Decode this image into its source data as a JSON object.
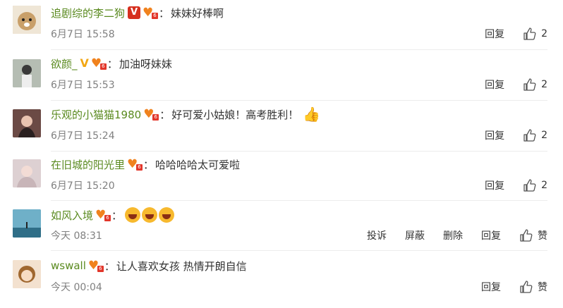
{
  "comments": [
    {
      "user": "追剧综的李二狗",
      "badge": "V",
      "text": "妹妹好棒啊",
      "time": "6月7日 15:58",
      "reply": "回复",
      "likes": "2",
      "avatar_color": "#c9a06a"
    },
    {
      "user": "欲颜_",
      "badge": "V",
      "text": "加油呀妹妹",
      "time": "6月7日 15:53",
      "reply": "回复",
      "likes": "2",
      "avatar_color": "#9aa39a"
    },
    {
      "user": "乐观的小猫猫1980",
      "badge": "",
      "text": "好可爱小姑娘！高考胜利！",
      "time": "6月7日 15:24",
      "reply": "回复",
      "likes": "2",
      "avatar_color": "#7a5a52"
    },
    {
      "user": "在旧城的阳光里",
      "badge": "",
      "text": "哈哈哈哈太可爱啦",
      "time": "6月7日 15:20",
      "reply": "回复",
      "likes": "2",
      "avatar_color": "#d8c9c8"
    },
    {
      "user": "如风入境",
      "badge": "",
      "text": "",
      "time": "今天 08:31",
      "report": "投诉",
      "block": "屏蔽",
      "delete": "删除",
      "reply": "回复",
      "likes": "赞",
      "avatar_color": "#4a8ea8"
    },
    {
      "user": "wswall",
      "badge": "",
      "text": "让人喜欢女孩 热情开朗自信",
      "time": "今天 00:04",
      "reply": "回复",
      "likes": "赞",
      "avatar_color": "#e9d2b7"
    }
  ],
  "colon": "：",
  "fan_level": "6"
}
